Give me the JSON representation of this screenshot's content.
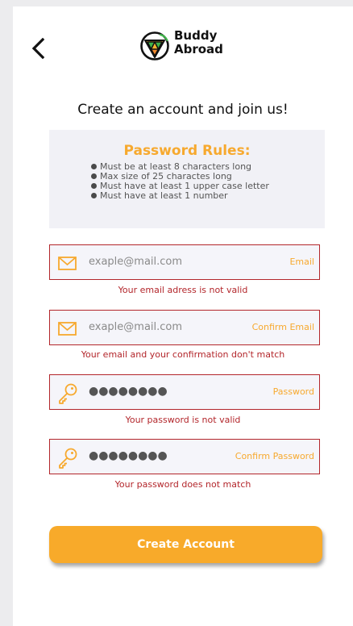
{
  "header": {
    "back_icon": "chevron-left-icon",
    "logo_line1": "Buddy",
    "logo_line2": "Abroad"
  },
  "headline": "Create an account and join us!",
  "password_rules": {
    "title": "Password Rules:",
    "items": [
      "Must be at least 8 characters long",
      "Max size of 25 charactes long",
      "Must have at least 1 upper case letter",
      "Must have at least 1 number"
    ]
  },
  "form": {
    "email": {
      "value": "exaple@mail.com",
      "label": "Email",
      "error": "Your email adress is not valid",
      "icon": "envelope-icon"
    },
    "confirm_email": {
      "value": "exaple@mail.com",
      "label": "Confirm Email",
      "error": "Your email and your confirmation don't match",
      "icon": "envelope-icon"
    },
    "password": {
      "value": "●●●●●●●●",
      "label": "Password",
      "error": "Your password is not valid",
      "icon": "key-icon"
    },
    "confirm_password": {
      "value": "●●●●●●●●",
      "label": "Confirm Password",
      "error": "Your password does not match",
      "icon": "key-icon"
    }
  },
  "submit_label": "Create Account",
  "colors": {
    "accent": "#f7a92e",
    "error": "#b3262b",
    "logo_green": "#3fb54a",
    "field_background": "#f5f5fa",
    "rules_background": "#f1f1f6"
  }
}
